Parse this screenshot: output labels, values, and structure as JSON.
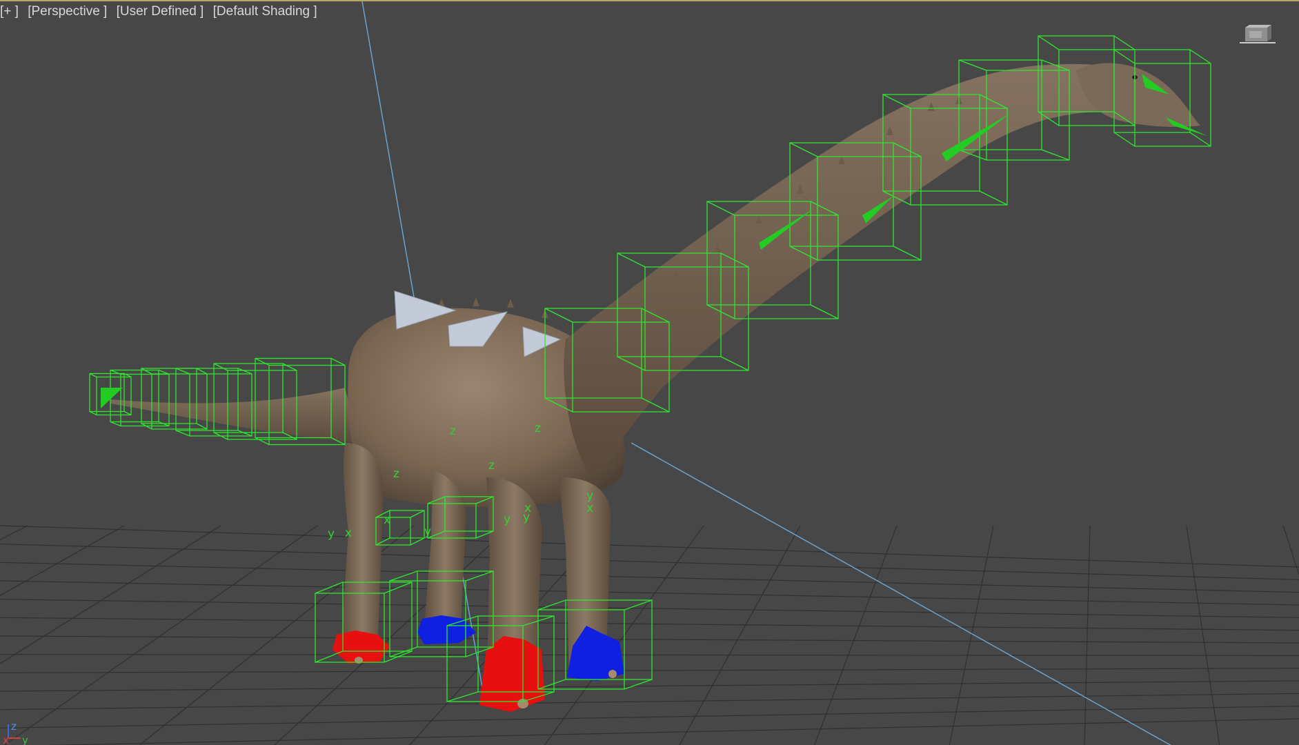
{
  "viewport": {
    "labels": {
      "menu": "[+ ]",
      "view": "[Perspective ]",
      "camera": "[User Defined ]",
      "shading": "[Default Shading ]"
    },
    "axis_markers": [
      "z",
      "z",
      "z",
      "z",
      "x",
      "x",
      "y",
      "y",
      "y",
      "y",
      "x",
      "x",
      "y"
    ],
    "tripod": {
      "z": "z",
      "x": "x",
      "y": "y"
    }
  },
  "colors": {
    "background": "#474747",
    "grid": "#2f2f2f",
    "bone": "#2ee82e",
    "foot_left": "#e61010",
    "foot_right": "#1020e0",
    "skin": "#8a7660",
    "camera_line": "#6aa8d8"
  },
  "icons": {
    "viewcube": "viewcube-icon",
    "tripod": "axis-tripod-icon"
  }
}
